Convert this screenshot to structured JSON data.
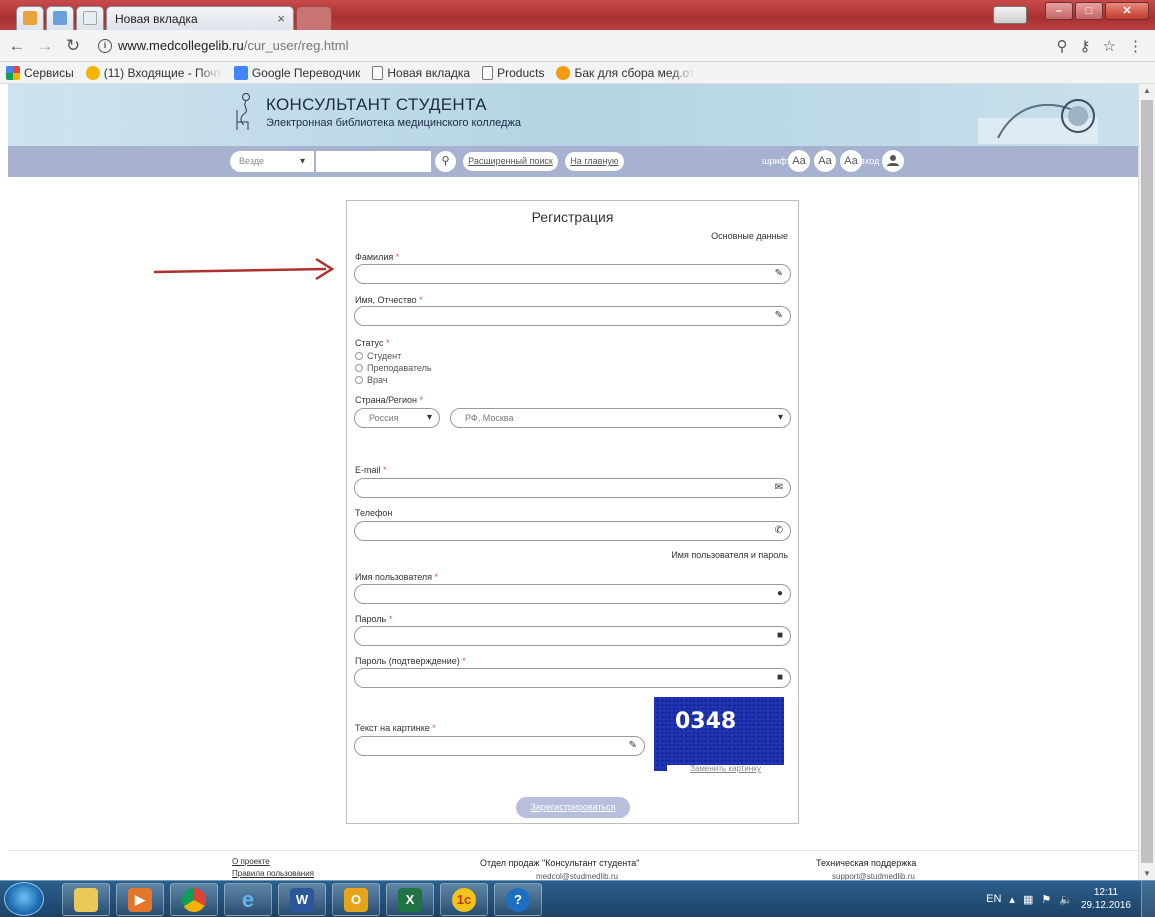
{
  "browser": {
    "tabs": [
      {
        "label": "Новая вкладка",
        "close": "×"
      }
    ],
    "url_host": "www.medcollegelib.ru",
    "url_path": "/cur_user/reg.html",
    "icons": [
      "back-icon",
      "forward-icon",
      "reload-icon",
      "info-icon",
      "zoom-icon",
      "key-icon",
      "star-icon",
      "menu-icon"
    ],
    "bookmarks": [
      {
        "label": "Сервисы",
        "color": "#e8453c"
      },
      {
        "label": "(11) Входящие - Почт",
        "color": "#f4b400"
      },
      {
        "label": "Google Переводчик",
        "color": "#4285f4"
      },
      {
        "label": "Новая вкладка",
        "color": "#9e9e9e"
      },
      {
        "label": "Products",
        "color": "#9e9e9e"
      },
      {
        "label": "Бак для сбора мед.от",
        "color": "#f39c12"
      }
    ]
  },
  "site": {
    "title": "КОНСУЛЬТАНТ СТУДЕНТА",
    "subtitle": "Электронная библиотека медицинского колледжа",
    "nav": {
      "scope": "Везде",
      "advanced_search": "Расширенный поиск",
      "home": "На главную",
      "font_label": "шрифт",
      "font_buttons": [
        "Aa",
        "Aa",
        "Aa"
      ],
      "login_label": "вход"
    },
    "accent": "#a7b2d1"
  },
  "form": {
    "title": "Регистрация",
    "section_basic": "Основные данные",
    "surname_label": "Фамилия",
    "name_label": "Имя, Отчество",
    "status_label": "Статус",
    "status_options": [
      "Студент",
      "Преподаватель",
      "Врач"
    ],
    "region_label": "Страна/Регион",
    "country": "Россия",
    "region": "РФ, Москва",
    "email_label": "E-mail",
    "phone_label": "Телефон",
    "section_login": "Имя пользователя и пароль",
    "username_label": "Имя пользователя",
    "password_label": "Пароль",
    "password_confirm_label": "Пароль (подтверждение)",
    "captcha_label": "Текст на картинке",
    "captcha_code": "0348",
    "captcha_change": "Заменить картинку",
    "submit": "Зарегистрироваться",
    "required_mark": "*"
  },
  "footer": {
    "links": [
      "О проекте",
      "Правила пользования"
    ],
    "sales_title": "Отдел продаж \"Консультант студента\"",
    "sales_email": "medcol@studmedlib.ru",
    "support_title": "Техническая поддержка",
    "support_email": "support@studmedlib.ru"
  },
  "taskbar": {
    "lang": "EN",
    "time": "12:11",
    "date": "29.12.2016",
    "apps": [
      "explorer",
      "media-player",
      "chrome",
      "internet-explorer",
      "word",
      "outlook",
      "excel",
      "1c",
      "help"
    ]
  }
}
